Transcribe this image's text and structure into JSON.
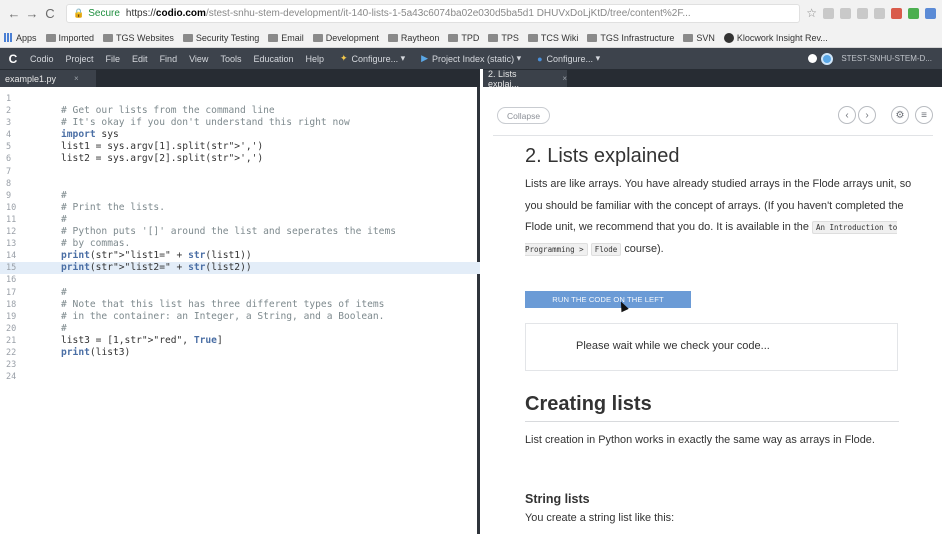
{
  "browser": {
    "nav_back": "←",
    "nav_forward": "→",
    "nav_reload": "C",
    "secure_label": "Secure",
    "url_scheme": "https://",
    "url_host": "codio.com",
    "url_rest": "/stest-snhu-stem-development/it-140-lists-1-5a43c6074ba02e030d5ba5d1 DHUVxDoLjKtD/tree/content%2F...",
    "bookmarks": [
      "Apps",
      "Imported",
      "TGS Websites",
      "Security Testing",
      "Email",
      "Development",
      "Raytheon",
      "TPD",
      "TPS",
      "TCS Wiki",
      "TGS Infrastructure",
      "SVN",
      "Klocwork Insight Rev..."
    ]
  },
  "menubar": {
    "logo": "C",
    "items": [
      "Codio",
      "Project",
      "File",
      "Edit",
      "Find",
      "View",
      "Tools",
      "Education",
      "Help"
    ],
    "configure1": "Configure...",
    "project_index": "Project Index (static)",
    "configure2": "Configure...",
    "user": "STEST-SNHU-STEM-D..."
  },
  "editor": {
    "tab_label": "example1.py",
    "tab_close": "×",
    "line_numbers": [
      "1",
      "2",
      "3",
      "4",
      "5",
      "6",
      "7",
      "8",
      "9",
      "10",
      "11",
      "12",
      "13",
      "14",
      "15",
      "16",
      "17",
      "18",
      "19",
      "20",
      "21",
      "22",
      "23",
      "24"
    ],
    "lines": [
      "",
      "# Get our lists from the command line",
      "# It's okay if you don't understand this right now",
      "import sys",
      "list1 = sys.argv[1].split(',')",
      "list2 = sys.argv[2].split(',')",
      "",
      "",
      "#",
      "# Print the lists.",
      "#",
      "# Python puts '[]' around the list and seperates the items",
      "# by commas.",
      "print(\"list1=\" + str(list1))",
      "print(\"list2=\" + str(list2))",
      "",
      "#",
      "# Note that this list has three different types of items",
      "# in the container: an Integer, a String, and a Boolean.",
      "#",
      "list3 = [1,\"red\", True]",
      "print(list3)",
      "",
      ""
    ],
    "highlighted_line": 15
  },
  "guide": {
    "tab_label": "2. Lists explai...",
    "tab_close": "×",
    "collapse_label": "Collapse",
    "prev_label": "‹",
    "next_label": "›",
    "settings_label": "⚙",
    "menu_label": "≡",
    "section_title": "2. Lists explained",
    "intro_1": "Lists are like arrays. You have already studied arrays in the Flode arrays unit, so you should be familiar with the concept of arrays. (If you haven't completed the Flode unit, we recommend that you do. It is available in the ",
    "intro_chip_1": "An Introduction to Programming >",
    "intro_chip_2": "Flode",
    "intro_2": " course).",
    "run_button": "RUN THE CODE ON THE LEFT",
    "wait_message": "Please wait while we check your code...",
    "creating_title": "Creating lists",
    "creating_text": "List creation in Python works in exactly the same way as arrays in Flode.",
    "string_lists_title": "String lists",
    "string_lists_text": "You create a string list like this:"
  },
  "colors": {
    "menubar_bg": "#3d434c",
    "run_button_bg": "#6b9bd6",
    "highlight_line": "#e3edf8"
  }
}
